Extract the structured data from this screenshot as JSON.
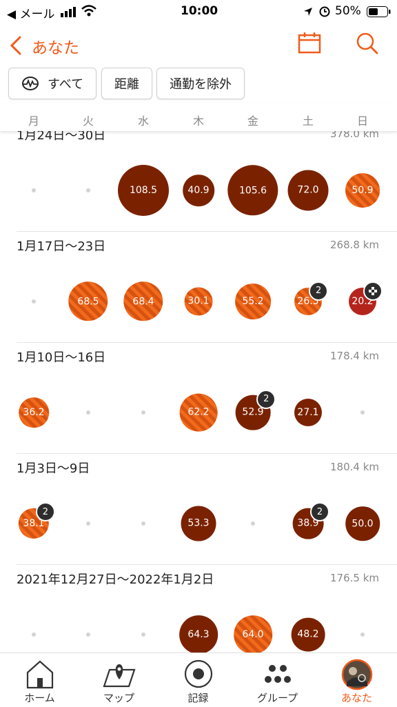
{
  "status": {
    "carrier": "◀ メール",
    "time": "10:00",
    "battery": "50%"
  },
  "nav": {
    "back_label": "あなた"
  },
  "filters": [
    {
      "label": "すべて"
    },
    {
      "label": "距離"
    },
    {
      "label": "通勤を除外"
    }
  ],
  "weekdays": [
    "月",
    "火",
    "水",
    "木",
    "金",
    "土",
    "日"
  ],
  "colors": {
    "accent": "#f05a1a",
    "solid": "#7a2200",
    "striped": "#f26a1b",
    "red": "#b5241c"
  },
  "weeks": [
    {
      "title": "1月24日〜30日",
      "total": "378.0 km",
      "days": [
        null,
        null,
        {
          "v": "108.5",
          "style": "solid"
        },
        {
          "v": "40.9",
          "style": "solid"
        },
        {
          "v": "105.6",
          "style": "solid"
        },
        {
          "v": "72.0",
          "style": "solid"
        },
        {
          "v": "50.9",
          "style": "striped"
        }
      ]
    },
    {
      "title": "1月17日〜23日",
      "total": "268.8 km",
      "days": [
        null,
        {
          "v": "68.5",
          "style": "striped"
        },
        {
          "v": "68.4",
          "style": "striped"
        },
        {
          "v": "30.1",
          "style": "striped"
        },
        {
          "v": "55.2",
          "style": "striped"
        },
        {
          "v": "26.3",
          "style": "striped",
          "badge": "2"
        },
        {
          "v": "20.2",
          "style": "red",
          "badge": "flag"
        }
      ]
    },
    {
      "title": "1月10日〜16日",
      "total": "178.4 km",
      "days": [
        {
          "v": "36.2",
          "style": "striped"
        },
        null,
        null,
        {
          "v": "62.2",
          "style": "striped"
        },
        {
          "v": "52.9",
          "style": "solid",
          "badge": "2"
        },
        {
          "v": "27.1",
          "style": "solid"
        },
        null
      ]
    },
    {
      "title": "1月3日〜9日",
      "total": "180.4 km",
      "days": [
        {
          "v": "38.1",
          "style": "striped",
          "badge": "2"
        },
        null,
        null,
        {
          "v": "53.3",
          "style": "solid"
        },
        null,
        {
          "v": "38.9",
          "style": "solid",
          "badge": "2"
        },
        {
          "v": "50.0",
          "style": "solid"
        }
      ]
    },
    {
      "title": "2021年12月27日〜2022年1月2日",
      "total": "176.5 km",
      "days": [
        null,
        null,
        null,
        {
          "v": "64.3",
          "style": "solid"
        },
        {
          "v": "64.0",
          "style": "striped"
        },
        {
          "v": "48.2",
          "style": "solid"
        },
        null
      ]
    }
  ],
  "tabs": [
    {
      "label": "ホーム",
      "icon": "home-icon"
    },
    {
      "label": "マップ",
      "icon": "map-icon"
    },
    {
      "label": "記録",
      "icon": "record-icon"
    },
    {
      "label": "グループ",
      "icon": "groups-icon"
    },
    {
      "label": "あなた",
      "icon": "avatar",
      "active": true
    }
  ]
}
